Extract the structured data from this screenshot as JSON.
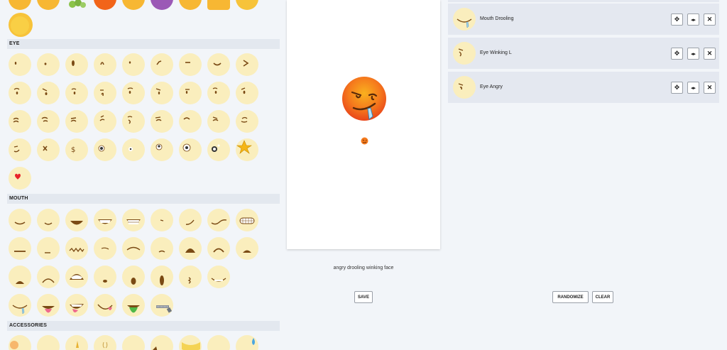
{
  "sections": {
    "eye": {
      "title": "EYE"
    },
    "mouth": {
      "title": "MOUTH"
    },
    "accessories": {
      "title": "ACCESSORIES"
    }
  },
  "canvas": {
    "face_name": "angry drooling winking face",
    "save_label": "SAVE"
  },
  "layers": {
    "items": [
      {
        "name": "Mouth Drooling"
      },
      {
        "name": "Eye Winking L"
      },
      {
        "name": "Eye Angry"
      }
    ],
    "move_icon": "move-icon",
    "flip_icon": "flip-horizontal-icon",
    "remove_icon": "close-icon",
    "randomize_label": "RANDOMIZE",
    "clear_label": "CLEAR"
  },
  "colors": {
    "face_fill": "#faeebd",
    "feature_brown": "#7a4a14",
    "emoji_red": "#f5541c",
    "emoji_orange": "#f9a11b",
    "section_bg": "#e3e8ef",
    "layer_bg": "#e4e8f0"
  }
}
